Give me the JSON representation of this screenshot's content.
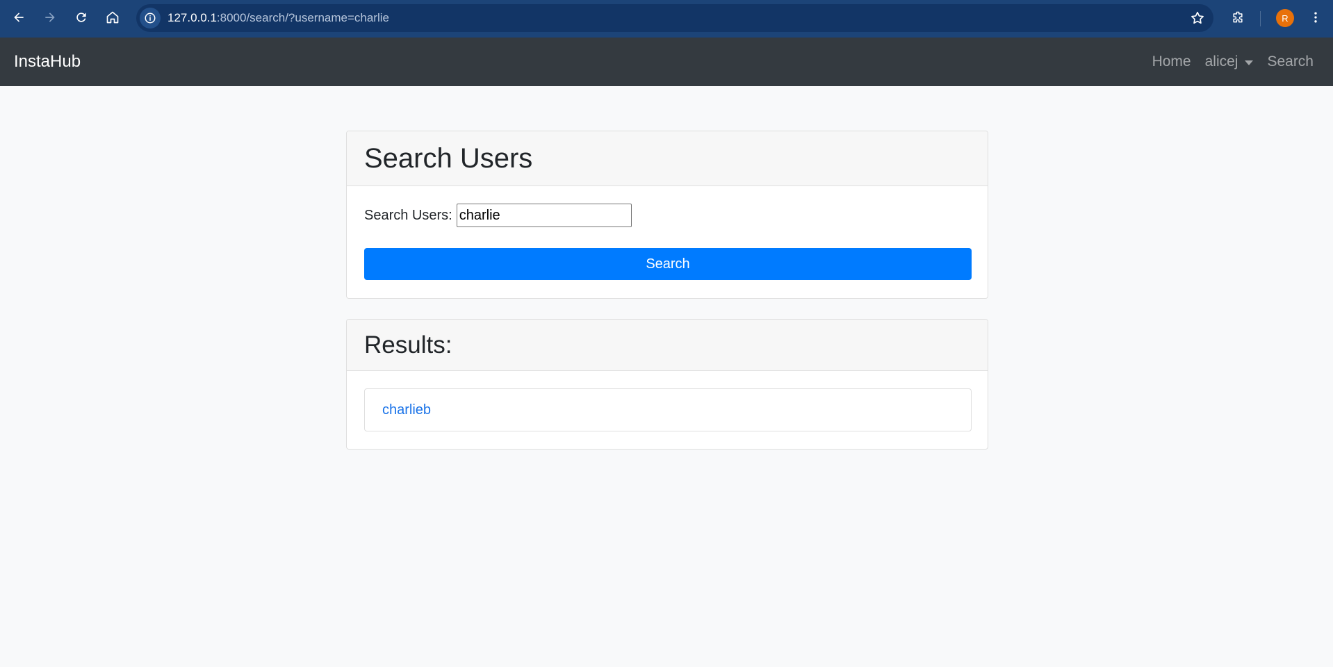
{
  "browser": {
    "url_host": "127.0.0.1",
    "url_path": ":8000/search/?username=charlie",
    "profile_initial": "R",
    "icons": [
      "back-icon",
      "forward-icon",
      "reload-icon",
      "home-icon",
      "info-icon",
      "star-icon",
      "extensions-icon",
      "menu-icon"
    ]
  },
  "navbar": {
    "brand": "InstaHub",
    "links": {
      "home": "Home",
      "user": "alicej",
      "search": "Search"
    }
  },
  "search_card": {
    "title": "Search Users",
    "label": "Search Users:",
    "input_value": "charlie",
    "button_label": "Search"
  },
  "results_card": {
    "title": "Results:",
    "items": [
      {
        "username": "charlieb"
      }
    ]
  },
  "colors": {
    "chrome": "#1c4478",
    "navbar": "#343a40",
    "primary": "#007bff",
    "link": "#1a73e8",
    "page_bg": "#f8f9fa"
  }
}
